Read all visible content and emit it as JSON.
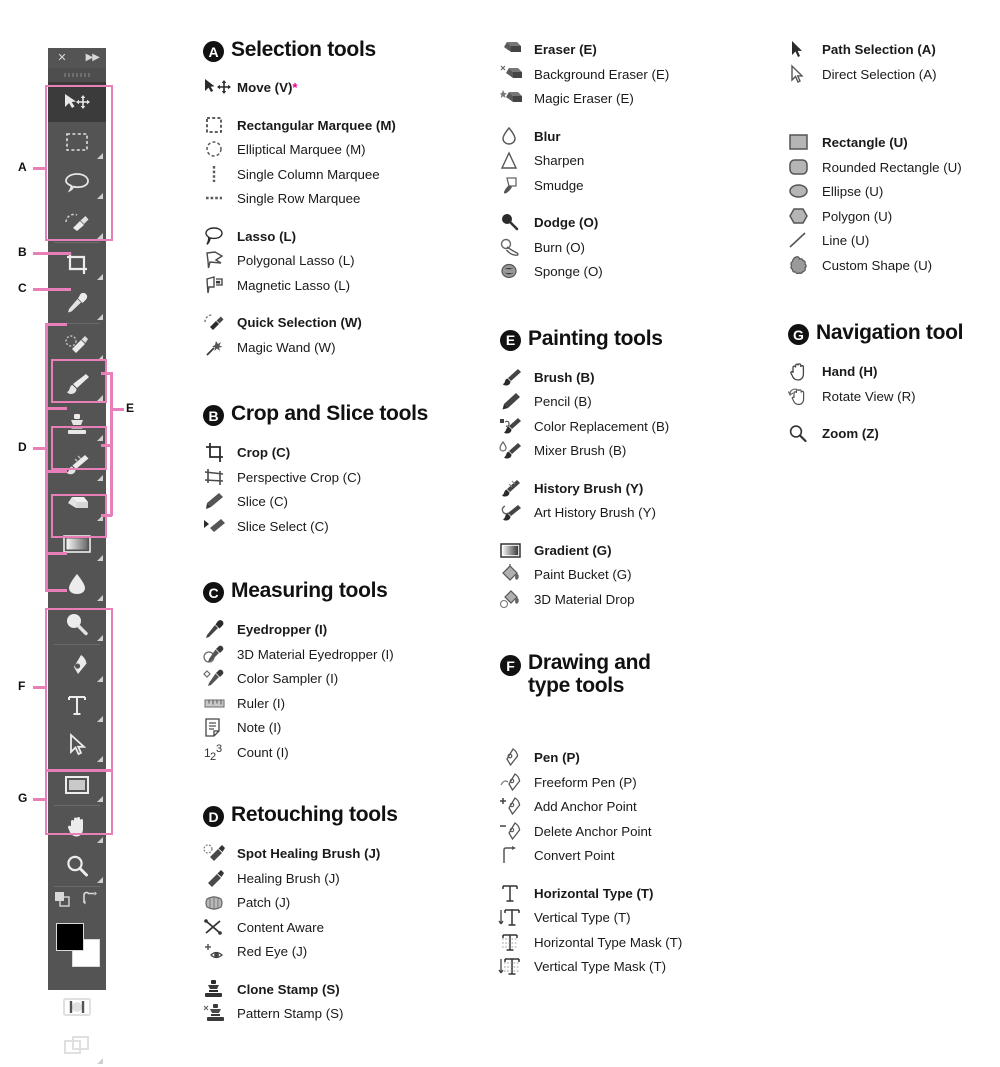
{
  "accent_color": "#e87fb8",
  "asterisk_color": "#ec008c",
  "toolbar": {
    "close_icon": "✕",
    "collapse_icon": "»",
    "panel_bg": "#545454",
    "selected_tool": "Move",
    "bracket_labels": [
      "A",
      "B",
      "C",
      "D",
      "E",
      "F",
      "G"
    ],
    "bottom": {
      "foreground_color": "#000000",
      "background_color": "#ffffff",
      "swap_icon": "swap-colors-icon",
      "default_icon": "default-colors-icon",
      "quick_mask_label": "quick-mask-icon",
      "screen_mode_label": "screen-mode-icon"
    }
  },
  "sections": [
    {
      "letter": "A",
      "title": "Selection tools",
      "groups": [
        {
          "tools": [
            {
              "name": "Move (V)",
              "bold": true,
              "asterisk": true,
              "icon": "move-icon"
            }
          ]
        },
        {
          "tools": [
            {
              "name": "Rectangular Marquee (M)",
              "bold": true,
              "icon": "rectangular-marquee-icon"
            },
            {
              "name": "Elliptical Marquee (M)",
              "bold": false,
              "icon": "elliptical-marquee-icon"
            },
            {
              "name": "Single Column Marquee",
              "bold": false,
              "icon": "single-column-marquee-icon"
            },
            {
              "name": "Single Row Marquee",
              "bold": false,
              "icon": "single-row-marquee-icon"
            }
          ]
        },
        {
          "tools": [
            {
              "name": "Lasso (L)",
              "bold": true,
              "icon": "lasso-icon"
            },
            {
              "name": "Polygonal Lasso (L)",
              "bold": false,
              "icon": "polygonal-lasso-icon"
            },
            {
              "name": "Magnetic Lasso (L)",
              "bold": false,
              "icon": "magnetic-lasso-icon"
            }
          ]
        },
        {
          "tools": [
            {
              "name": "Quick Selection (W)",
              "bold": true,
              "icon": "quick-selection-icon"
            },
            {
              "name": "Magic Wand (W)",
              "bold": false,
              "icon": "magic-wand-icon"
            }
          ]
        }
      ]
    },
    {
      "letter": "B",
      "title": "Crop and Slice tools",
      "groups": [
        {
          "tools": [
            {
              "name": "Crop (C)",
              "bold": true,
              "icon": "crop-icon"
            },
            {
              "name": "Perspective Crop (C)",
              "bold": false,
              "icon": "perspective-crop-icon"
            },
            {
              "name": "Slice (C)",
              "bold": false,
              "icon": "slice-icon"
            },
            {
              "name": "Slice Select (C)",
              "bold": false,
              "icon": "slice-select-icon"
            }
          ]
        }
      ]
    },
    {
      "letter": "C",
      "title": "Measuring tools",
      "groups": [
        {
          "tools": [
            {
              "name": "Eyedropper (I)",
              "bold": true,
              "icon": "eyedropper-icon"
            },
            {
              "name": "3D Material Eyedropper (I)",
              "bold": false,
              "icon": "3d-material-eyedropper-icon"
            },
            {
              "name": "Color Sampler (I)",
              "bold": false,
              "icon": "color-sampler-icon"
            },
            {
              "name": "Ruler (I)",
              "bold": false,
              "icon": "ruler-icon"
            },
            {
              "name": "Note (I)",
              "bold": false,
              "icon": "note-icon"
            },
            {
              "name": "Count (I)",
              "bold": false,
              "icon": "count-icon"
            }
          ]
        }
      ]
    },
    {
      "letter": "D",
      "title": "Retouching tools",
      "groups": [
        {
          "tools": [
            {
              "name": "Spot Healing Brush (J)",
              "bold": true,
              "icon": "spot-healing-brush-icon"
            },
            {
              "name": "Healing Brush (J)",
              "bold": false,
              "icon": "healing-brush-icon"
            },
            {
              "name": "Patch (J)",
              "bold": false,
              "icon": "patch-icon"
            },
            {
              "name": "Content Aware",
              "bold": false,
              "icon": "content-aware-icon"
            },
            {
              "name": "Red Eye (J)",
              "bold": false,
              "icon": "red-eye-icon"
            }
          ]
        },
        {
          "tools": [
            {
              "name": "Clone Stamp (S)",
              "bold": true,
              "icon": "clone-stamp-icon"
            },
            {
              "name": "Pattern Stamp (S)",
              "bold": false,
              "icon": "pattern-stamp-icon"
            }
          ]
        }
      ]
    },
    {
      "letter": "",
      "title": "",
      "continued": true,
      "groups": [
        {
          "tools": [
            {
              "name": "Eraser (E)",
              "bold": true,
              "icon": "eraser-icon"
            },
            {
              "name": "Background Eraser (E)",
              "bold": false,
              "icon": "background-eraser-icon"
            },
            {
              "name": "Magic Eraser (E)",
              "bold": false,
              "icon": "magic-eraser-icon"
            }
          ]
        },
        {
          "tools": [
            {
              "name": "Blur",
              "bold": true,
              "icon": "blur-icon"
            },
            {
              "name": "Sharpen",
              "bold": false,
              "icon": "sharpen-icon"
            },
            {
              "name": "Smudge",
              "bold": false,
              "icon": "smudge-icon"
            }
          ]
        },
        {
          "tools": [
            {
              "name": "Dodge (O)",
              "bold": true,
              "icon": "dodge-icon"
            },
            {
              "name": "Burn (O)",
              "bold": false,
              "icon": "burn-icon"
            },
            {
              "name": "Sponge (O)",
              "bold": false,
              "icon": "sponge-icon"
            }
          ]
        }
      ]
    },
    {
      "letter": "E",
      "title": "Painting tools",
      "groups": [
        {
          "tools": [
            {
              "name": "Brush (B)",
              "bold": true,
              "icon": "brush-icon"
            },
            {
              "name": "Pencil (B)",
              "bold": false,
              "icon": "pencil-icon"
            },
            {
              "name": "Color Replacement (B)",
              "bold": false,
              "icon": "color-replacement-icon"
            },
            {
              "name": "Mixer Brush (B)",
              "bold": false,
              "icon": "mixer-brush-icon"
            }
          ]
        },
        {
          "tools": [
            {
              "name": "History Brush (Y)",
              "bold": true,
              "icon": "history-brush-icon"
            },
            {
              "name": "Art History Brush (Y)",
              "bold": false,
              "icon": "art-history-brush-icon"
            }
          ]
        },
        {
          "tools": [
            {
              "name": "Gradient (G)",
              "bold": true,
              "icon": "gradient-icon"
            },
            {
              "name": "Paint Bucket (G)",
              "bold": false,
              "icon": "paint-bucket-icon"
            },
            {
              "name": "3D Material Drop",
              "bold": false,
              "icon": "3d-material-drop-icon"
            }
          ]
        }
      ]
    },
    {
      "letter": "F",
      "title": "Drawing and type tools",
      "title_lines": [
        "Drawing and",
        "type tools"
      ],
      "groups": [
        {
          "tools": [
            {
              "name": "Pen (P)",
              "bold": true,
              "icon": "pen-icon"
            },
            {
              "name": "Freeform Pen (P)",
              "bold": false,
              "icon": "freeform-pen-icon"
            },
            {
              "name": "Add Anchor Point",
              "bold": false,
              "icon": "add-anchor-point-icon"
            },
            {
              "name": "Delete Anchor Point",
              "bold": false,
              "icon": "delete-anchor-point-icon"
            },
            {
              "name": "Convert Point",
              "bold": false,
              "icon": "convert-point-icon"
            }
          ]
        },
        {
          "tools": [
            {
              "name": "Horizontal Type (T)",
              "bold": true,
              "icon": "horizontal-type-icon"
            },
            {
              "name": "Vertical Type (T)",
              "bold": false,
              "icon": "vertical-type-icon"
            },
            {
              "name": "Horizontal Type Mask (T)",
              "bold": false,
              "icon": "horizontal-type-mask-icon"
            },
            {
              "name": "Vertical Type Mask (T)",
              "bold": false,
              "icon": "vertical-type-mask-icon"
            }
          ]
        }
      ]
    },
    {
      "letter": "",
      "title": "",
      "continued": true,
      "groups": [
        {
          "tools": [
            {
              "name": "Path Selection (A)",
              "bold": true,
              "icon": "path-selection-icon"
            },
            {
              "name": "Direct Selection (A)",
              "bold": false,
              "icon": "direct-selection-icon"
            }
          ]
        },
        {
          "tools": [
            {
              "name": "Rectangle (U)",
              "bold": true,
              "icon": "rectangle-icon"
            },
            {
              "name": "Rounded Rectangle (U)",
              "bold": false,
              "icon": "rounded-rectangle-icon"
            },
            {
              "name": "Ellipse (U)",
              "bold": false,
              "icon": "ellipse-icon"
            },
            {
              "name": "Polygon (U)",
              "bold": false,
              "icon": "polygon-icon"
            },
            {
              "name": "Line (U)",
              "bold": false,
              "icon": "line-icon"
            },
            {
              "name": "Custom Shape (U)",
              "bold": false,
              "icon": "custom-shape-icon"
            }
          ]
        }
      ]
    },
    {
      "letter": "G",
      "title": "Navigation tool",
      "groups": [
        {
          "tools": [
            {
              "name": "Hand (H)",
              "bold": true,
              "icon": "hand-icon"
            },
            {
              "name": "Rotate View (R)",
              "bold": false,
              "icon": "rotate-view-icon"
            }
          ]
        },
        {
          "tools": [
            {
              "name": "Zoom (Z)",
              "bold": true,
              "icon": "zoom-icon"
            }
          ]
        }
      ]
    }
  ]
}
